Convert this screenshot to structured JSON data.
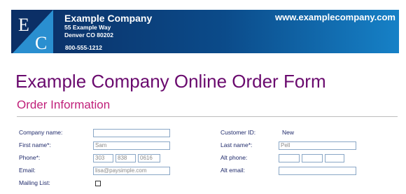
{
  "header": {
    "logo_letters": [
      "E",
      "C"
    ],
    "company_name": "Example Company",
    "address_line1": "55 Example Way",
    "address_line2": "Denver CO  80202",
    "phone": "800-555-1212",
    "website": "www.examplecompany.com"
  },
  "form": {
    "title": "Example Company Online Order Form",
    "section_title": "Order Information",
    "company_name_label": "Company name:",
    "company_name_value": "",
    "first_name_label": "First name*:",
    "first_name_value": "Sam",
    "phone_label": "Phone*:",
    "phone_parts": [
      "303",
      "838",
      "0616"
    ],
    "email_label": "Email:",
    "email_value": "lisa@paysimple.com",
    "mailing_list_label": "Mailing List:",
    "customer_id_label": "Customer ID:",
    "customer_id_value": "New",
    "last_name_label": "Last name*:",
    "last_name_value": "Pell",
    "alt_phone_label": "Alt phone:",
    "alt_phone_parts": [
      "",
      "",
      ""
    ],
    "alt_email_label": "Alt email:",
    "alt_email_value": ""
  },
  "colors": {
    "banner_dark": "#0b2d63",
    "banner_light": "#1681c7",
    "title_purple": "#6a0a6e",
    "section_magenta": "#c0207a",
    "label_navy": "#1f2a6b"
  }
}
